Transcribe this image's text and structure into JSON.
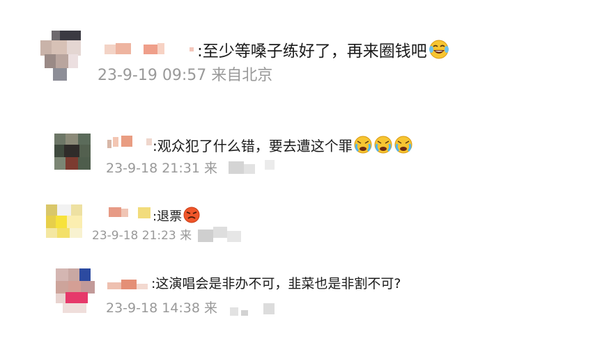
{
  "comments": [
    {
      "text": ":至少等嗓子练好了，再来圈钱吧",
      "emojis": [
        "laugh-cry-emoji"
      ],
      "time": "23-9-19 09:57",
      "location": "来自北京"
    },
    {
      "text": ":观众犯了什么错，要去遭这个罪",
      "emojis": [
        "crying-emoji",
        "crying-emoji",
        "crying-emoji"
      ],
      "time": "23-9-18 21:31",
      "location": "来"
    },
    {
      "text": ":退票",
      "emojis": [
        "angry-emoji"
      ],
      "time": "23-9-18 21:23",
      "location": "来"
    },
    {
      "text": ":这演唱会是非办不可，韭菜也是非割不可?",
      "emojis": [],
      "time": "23-9-18 14:38",
      "location": "来"
    }
  ],
  "colors": {
    "text": "#1a1a1a",
    "meta": "#999999"
  }
}
